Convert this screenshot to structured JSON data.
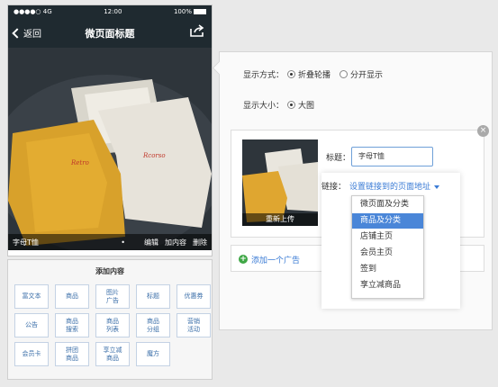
{
  "status_bar": {
    "signal": "●●●●○ 4G",
    "time": "12:00",
    "battery": "100%"
  },
  "header": {
    "back_label": "返回",
    "title": "微页面标题"
  },
  "preview": {
    "caption": "字母T恤",
    "dot": "•",
    "actions": [
      "编辑",
      "加内容",
      "删除"
    ]
  },
  "add_content": {
    "title": "添加内容",
    "buttons": [
      [
        "富文本"
      ],
      [
        "商品"
      ],
      [
        "图片",
        "广告"
      ],
      [
        "标题"
      ],
      [
        "优惠券"
      ],
      [
        "公告"
      ],
      [
        "商品",
        "搜索"
      ],
      [
        "商品",
        "列表"
      ],
      [
        "商品",
        "分组"
      ],
      [
        "营销",
        "活动"
      ],
      [
        "会员卡"
      ],
      [
        "拼团",
        "商品"
      ],
      [
        "享立减",
        "商品"
      ],
      [
        "魔方"
      ]
    ]
  },
  "editor": {
    "display_mode_label": "显示方式：",
    "display_mode_options": [
      "折叠轮播",
      "分开显示"
    ],
    "display_mode_selected": "折叠轮播",
    "display_size_label": "显示大小：",
    "display_size_options": [
      "大图"
    ],
    "display_size_selected": "大图",
    "close_glyph": "×",
    "reupload_label": "重新上传",
    "title_label": "标题：",
    "title_value": "字母T恤",
    "link_label": "链接：",
    "link_placeholder": "设置链接到的页面地址",
    "link_options": [
      "微页面及分类",
      "商品及分类",
      "店铺主页",
      "会员主页",
      "签到",
      "享立减商品"
    ],
    "link_selected_index": 1,
    "add_ad_glyph": "+",
    "add_ad_label": "添加一个广告"
  },
  "colors": {
    "dark_bar": "#1f2a30",
    "link_blue": "#3a7bd5",
    "selected_blue": "#4a86d8",
    "add_green": "#3fa746"
  }
}
